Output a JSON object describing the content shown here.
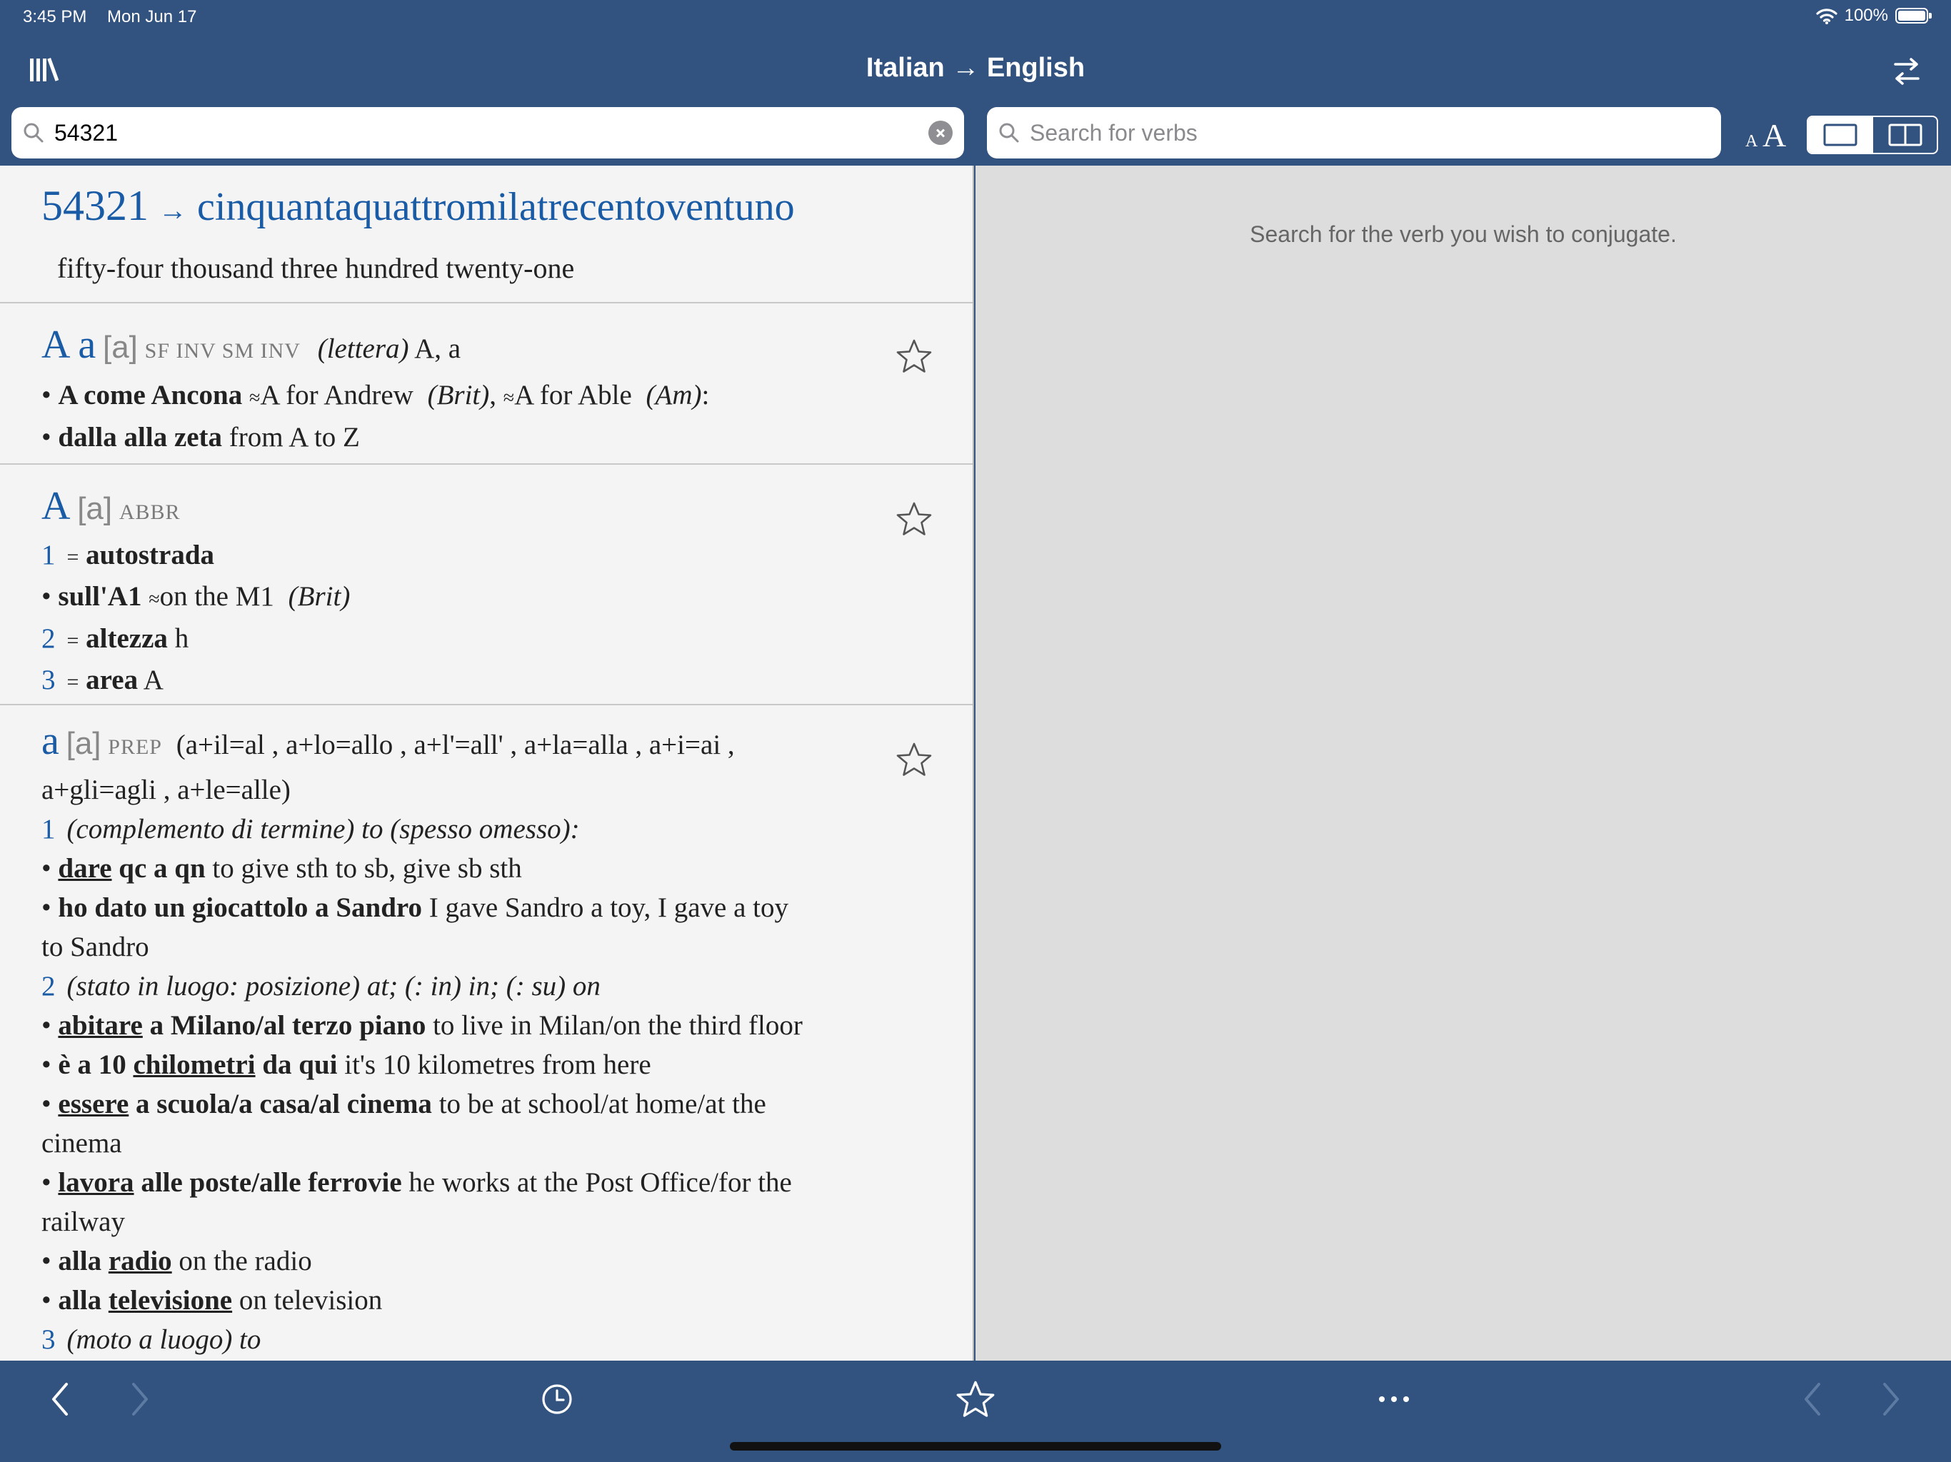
{
  "status_bar": {
    "time": "3:45 PM",
    "date": "Mon Jun 17",
    "battery": "100%"
  },
  "nav": {
    "title": "Italian → English"
  },
  "search": {
    "query": "54321",
    "verbs_placeholder": "Search for verbs"
  },
  "font_size": {
    "small": "A",
    "big": "A"
  },
  "right_panel": {
    "hint": "Search for the verb you wish to conjugate."
  },
  "number_entry": {
    "number": "54321",
    "arrow": "→",
    "italian": "cinquantaquattromilatrecentoventuno",
    "english": "fifty-four thousand three hundred twenty-one"
  },
  "entry_A_letter": {
    "hw": "A a",
    "pron": "[a]",
    "pos": "SF INV SM INV",
    "l1_ital": "(lettera)",
    "l1_trans": "A, a",
    "ex1_bold": "A come Ancona",
    "ex1_approx1": "≈",
    "ex1_t1": "A for Andrew",
    "ex1_reg1": "(Brit)",
    "ex1_comma": ",",
    "ex1_approx2": "≈",
    "ex1_t2": "A for Able",
    "ex1_reg2": "(Am)",
    "ex1_colon": ":",
    "ex2_bold": "dalla alla zeta",
    "ex2_trans": "from A to Z"
  },
  "entry_A_abbr": {
    "hw": "A",
    "pron": "[a]",
    "pos": "ABBR",
    "s1_num": "1",
    "s1_eq": "=",
    "s1_bold": "autostrada",
    "ex1_bold": "sull'A1",
    "ex1_approx": "≈",
    "ex1_trans": "on the M1",
    "ex1_reg": "(Brit)",
    "s2_num": "2",
    "s2_eq": "=",
    "s2_bold": "altezza",
    "s2_trans": "h",
    "s3_num": "3",
    "s3_eq": "=",
    "s3_bold": "area",
    "s3_trans": "A"
  },
  "entry_a_prep": {
    "hw": "a",
    "pron": "[a]",
    "pos": "PREP",
    "contractions_1": "(a+il=al , a+lo=allo , a+l'=all' , a+la=alla , a+i=ai ,",
    "contractions_2": "a+gli=agli , a+le=alle)",
    "s1_num": "1",
    "s1_text": "(complemento di termine) to (spesso omesso):",
    "ex1_u": "dare",
    "ex1_bold": "qc a qn",
    "ex1_trans": "to give sth to sb, give sb sth",
    "ex2_bold": "ho dato un giocattolo a Sandro",
    "ex2_trans": "I gave Sandro a toy, I gave a toy",
    "ex2_cont": "to Sandro",
    "s2_num": "2",
    "s2_text": "(stato in luogo: posizione) at; (: in) in; (: su) on",
    "ex3_u": "abitare",
    "ex3_bold": "a Milano/al terzo piano",
    "ex3_trans": "to live in Milan/on the third floor",
    "ex4_pre": "è a 10",
    "ex4_u": "chilometri",
    "ex4_bold": "da qui",
    "ex4_trans": "it's 10 kilometres from here",
    "ex5_u": "essere",
    "ex5_bold": "a scuola/a casa/al cinema",
    "ex5_trans": "to be at school/at home/at the",
    "ex5_cont": "cinema",
    "ex6_u": "lavora",
    "ex6_bold": "alle poste/alle ferrovie",
    "ex6_trans": "he works at the Post Office/for the",
    "ex6_cont": "railway",
    "ex7_pre": "alla",
    "ex7_u": "radio",
    "ex7_trans": "on the radio",
    "ex8_pre": "alla",
    "ex8_u": "televisione",
    "ex8_trans": "on television",
    "s3_num": "3",
    "s3_text": "(moto a luogo) to"
  },
  "bullet": "•"
}
